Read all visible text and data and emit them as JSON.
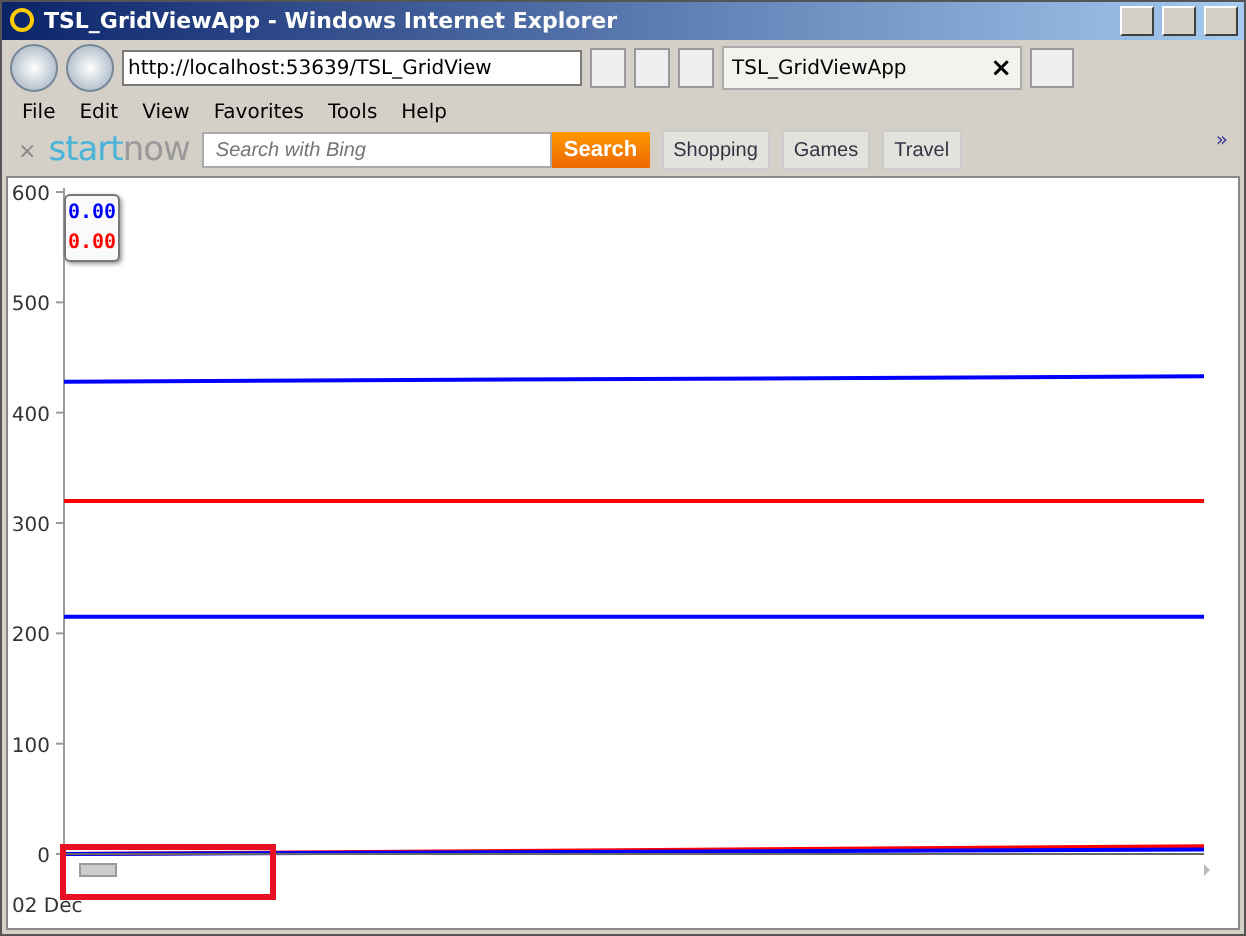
{
  "window": {
    "title": "TSL_GridViewApp - Windows Internet Explorer"
  },
  "address_bar": {
    "value": "http://localhost:53639/TSL_GridView"
  },
  "tabs": [
    {
      "label": "TSL_GridViewApp",
      "selected": true,
      "close": "×"
    }
  ],
  "menu": [
    "File",
    "Edit",
    "View",
    "Favorites",
    "Tools",
    "Help"
  ],
  "startnow": {
    "close": "×",
    "logo_start": "start",
    "logo_now": "now",
    "search": {
      "placeholder": "Search with Bing"
    },
    "search_button": "Search",
    "links": [
      "Shopping",
      "Games",
      "Travel"
    ],
    "more": "»"
  },
  "legend": [
    {
      "value": "0.00",
      "color": "#0000ff"
    },
    {
      "value": "0.00",
      "color": "#ff0000"
    }
  ],
  "x_axis_start_label": "02 Dec",
  "y_axis_labels": [
    "600",
    "500",
    "400",
    "300",
    "200",
    "100",
    "0"
  ]
}
